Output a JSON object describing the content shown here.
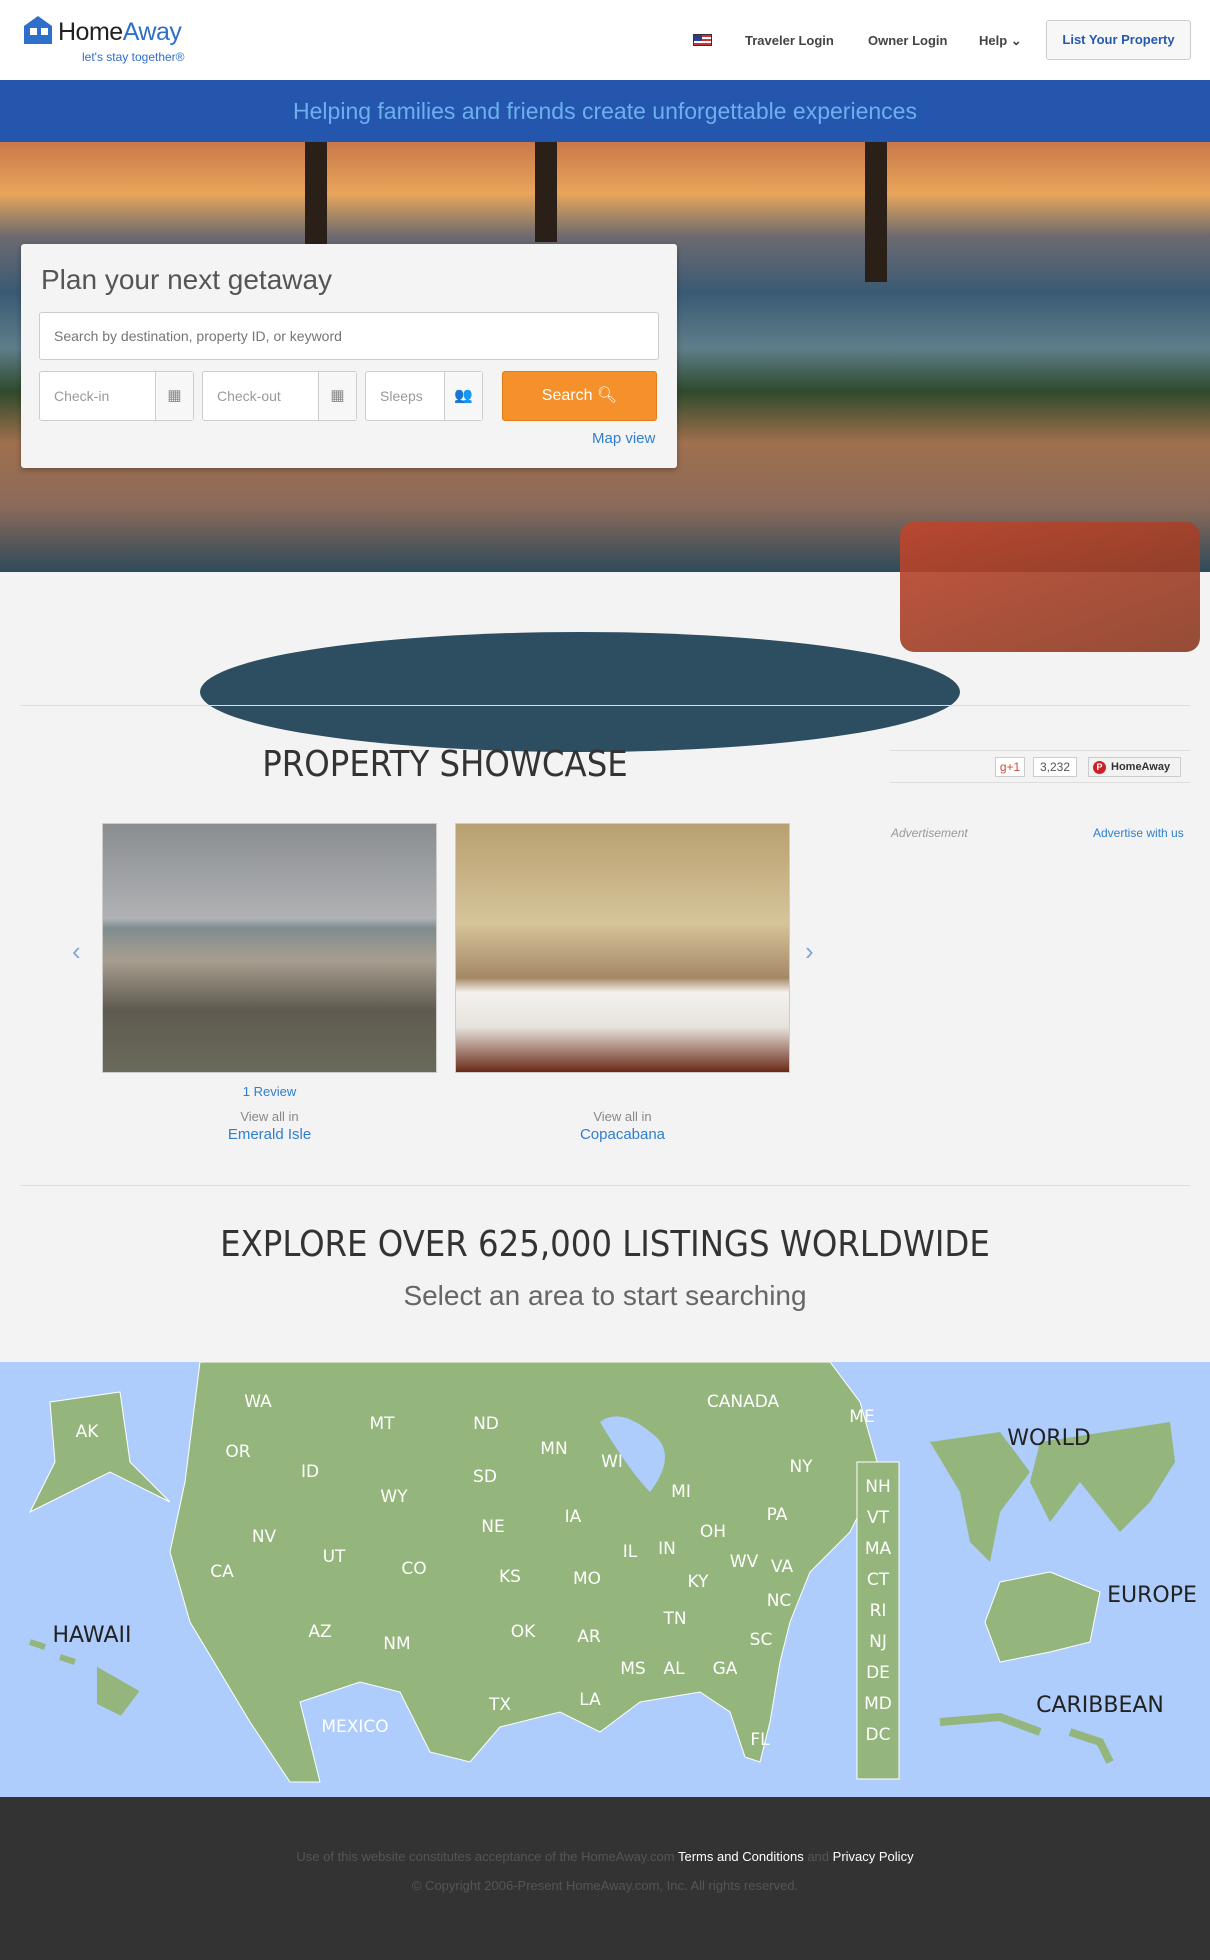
{
  "header": {
    "logo": "HomeAway",
    "logo_home": "Home",
    "logo_away": "Away",
    "tagline": "let's stay together®",
    "nav": [
      "Traveler Login",
      "Owner Login",
      "Help"
    ],
    "list_property": "List Your Property"
  },
  "banner": {
    "text": "Helping families and friends create unforgettable experiences"
  },
  "search": {
    "title": "Plan your next getaway",
    "destination_placeholder": "Search by destination, property ID, or keyword",
    "checkin_placeholder": "Check-in",
    "checkout_placeholder": "Check-out",
    "sleeps_placeholder": "Sleeps",
    "search_label": "Search",
    "map_view": "Map view"
  },
  "social": {
    "gplus": "+1",
    "gplus_count": "3,232",
    "pinterest": "HomeAway",
    "advertisement": "Advertisement",
    "advertise": "Advertise with us"
  },
  "showcase": {
    "title": "PROPERTY SHOWCASE",
    "items": [
      {
        "review": "1 Review",
        "view_all": "View all in",
        "city": "Emerald Isle"
      },
      {
        "review": "",
        "view_all": "View all in",
        "city": "Copacabana"
      }
    ]
  },
  "explore": {
    "title": "EXPLORE OVER 625,000 LISTINGS WORLDWIDE",
    "subtitle": "Select an area to start searching"
  },
  "map": {
    "colors": {
      "land": "#94b57c",
      "water": "#aecdfc"
    },
    "states": [
      "WA",
      "OR",
      "CA",
      "AK",
      "ID",
      "NV",
      "MT",
      "WY",
      "UT",
      "AZ",
      "CO",
      "NM",
      "ND",
      "SD",
      "NE",
      "KS",
      "OK",
      "TX",
      "MN",
      "IA",
      "MO",
      "AR",
      "LA",
      "WI",
      "IL",
      "MI",
      "IN",
      "OH",
      "KY",
      "TN",
      "MS",
      "AL",
      "GA",
      "FL",
      "SC",
      "NC",
      "VA",
      "WV",
      "PA",
      "NY",
      "ME"
    ],
    "small_states": [
      "NH",
      "VT",
      "MA",
      "CT",
      "RI",
      "NJ",
      "DE",
      "MD",
      "DC"
    ],
    "regions": [
      "CANADA",
      "MEXICO",
      "HAWAII",
      "WORLD",
      "EUROPE",
      "CARIBBEAN"
    ]
  },
  "footer": {
    "text1": "Use of this website constitutes acceptance of the HomeAway.com",
    "terms": "Terms and Conditions",
    "and": "and",
    "privacy": "Privacy Policy",
    "copyright": "© Copyright 2006-Present HomeAway.com, Inc. All rights reserved."
  }
}
